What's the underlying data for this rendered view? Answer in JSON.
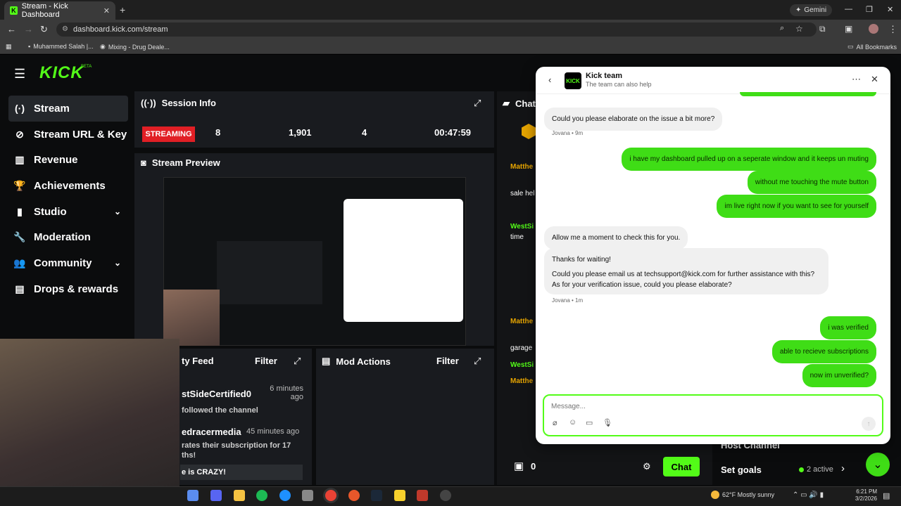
{
  "browser": {
    "tab_title": "Stream - Kick Dashboard",
    "url": "dashboard.kick.com/stream",
    "gemini_label": "Gemini",
    "bookmarks": [
      "Muhammed Salah |...",
      "Mixing - Drug Deale..."
    ],
    "all_bookmarks": "All Bookmarks"
  },
  "app": {
    "logo": "KICK",
    "beta": "BETA",
    "sidebar": [
      {
        "label": "Stream",
        "icon": "stream-icon",
        "glyph": "(·)"
      },
      {
        "label": "Stream URL & Key",
        "icon": "link-icon",
        "glyph": "⊘"
      },
      {
        "label": "Revenue",
        "icon": "revenue-icon",
        "glyph": "▥"
      },
      {
        "label": "Achievements",
        "icon": "trophy-icon",
        "glyph": "🏆"
      },
      {
        "label": "Studio",
        "icon": "studio-icon",
        "glyph": "▮"
      },
      {
        "label": "Moderation",
        "icon": "wrench-icon",
        "glyph": "🔧"
      },
      {
        "label": "Community",
        "icon": "community-icon",
        "glyph": "👥"
      },
      {
        "label": "Drops & rewards",
        "icon": "drops-icon",
        "glyph": "▤"
      }
    ],
    "session": {
      "title": "Session Info",
      "status": "STREAMING",
      "stats": [
        "8",
        "1,901",
        "4",
        "00:47:59"
      ]
    },
    "preview_title": "Stream Preview",
    "activity": {
      "title": "ty Feed",
      "filter": "Filter",
      "items": [
        {
          "user": "stSideCertified0",
          "time": "6 minutes ago",
          "text": "followed the channel"
        },
        {
          "user": "edracermedia",
          "time": "45 minutes ago",
          "text": "rates their subscription for 17 ths!"
        }
      ],
      "message": "e is CRAZY!"
    },
    "mod_actions": {
      "title": "Mod Actions",
      "filter": "Filter"
    },
    "chat": {
      "title": "Chat",
      "names": [
        "Matthe",
        "WestSi",
        "Matthe",
        "WestSi",
        "Matthe"
      ],
      "lines": [
        "sale hel",
        "time",
        "garage"
      ],
      "count": "0",
      "button": "Chat"
    },
    "right": {
      "host": "Host Channel",
      "goals": "Set goals",
      "active": "2 active"
    }
  },
  "support": {
    "name": "Kick team",
    "sub": "The team can also help",
    "messages": [
      {
        "side": "left",
        "text": "Could you please elaborate on the issue a bit more?"
      },
      {
        "side": "meta",
        "text": "Jovana • 9m"
      },
      {
        "side": "right",
        "text": "i have my dashboard pulled up on a seperate window and it keeps un muting"
      },
      {
        "side": "right",
        "text": "without me touching the mute button"
      },
      {
        "side": "right",
        "text": "im live right now if you want to see for yourself"
      },
      {
        "side": "left",
        "text": "Allow me a moment to check this for you."
      },
      {
        "side": "left",
        "text": "Thanks for waiting!"
      },
      {
        "side": "left",
        "text": "Could you please email us at techsupport@kick.com for further assistance with this?"
      },
      {
        "side": "left",
        "text": "As for your verification issue, could you please elaborate?"
      },
      {
        "side": "meta",
        "text": "Jovana • 1m"
      },
      {
        "side": "right",
        "text": "i was verified"
      },
      {
        "side": "right",
        "text": "able to recieve subscriptions"
      },
      {
        "side": "right",
        "text": "now im unverified?"
      }
    ],
    "placeholder": "Message..."
  },
  "taskbar": {
    "weather": "62°F  Mostly sunny",
    "time": "6:21 PM",
    "date": "3/2/2026"
  }
}
